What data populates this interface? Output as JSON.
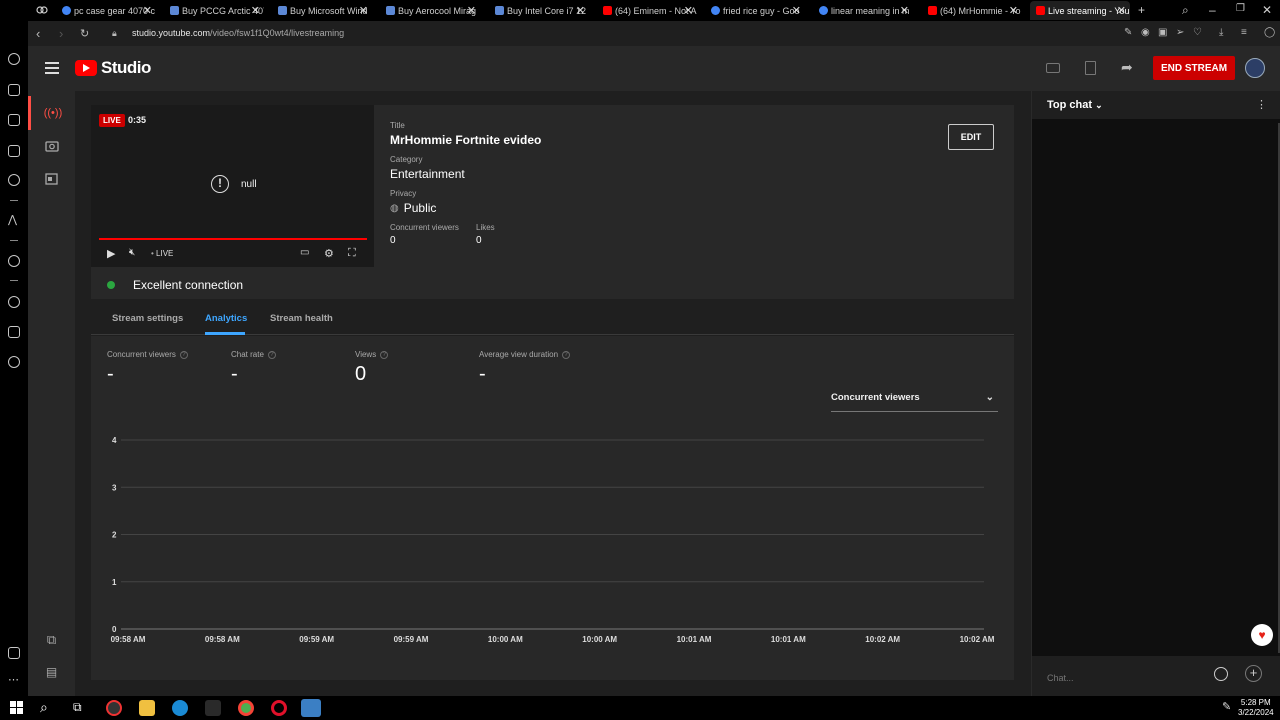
{
  "browser": {
    "tabs": [
      {
        "title": "pc case gear 4070 c",
        "fav": "g"
      },
      {
        "title": "Buy PCCG Arctic 407",
        "fav": "b"
      },
      {
        "title": "Buy Microsoft Wind",
        "fav": "b"
      },
      {
        "title": "Buy Aerocool Mirag",
        "fav": "b"
      },
      {
        "title": "Buy Intel Core i7 12",
        "fav": "b"
      },
      {
        "title": "(64) Eminem - Not A",
        "fav": "y"
      },
      {
        "title": "fried rice guy - Goo",
        "fav": "g"
      },
      {
        "title": "linear meaning in m",
        "fav": "g"
      },
      {
        "title": "(64) MrHommie - Yo",
        "fav": "y"
      },
      {
        "title": "Live streaming - You",
        "fav": "y",
        "active": true
      }
    ],
    "url_host": "studio.youtube.com",
    "url_path": "/video/fsw1f1Q0wt4/livestreaming"
  },
  "header": {
    "app_name": "Studio",
    "end_stream_label": "END STREAM"
  },
  "player": {
    "live_badge": "LIVE",
    "elapsed": "0:35",
    "error_text": "null",
    "live_indicator": "LIVE",
    "progress": 1.0
  },
  "connection": {
    "status": "Excellent connection",
    "color": "#2ba640"
  },
  "stream_info": {
    "title_label": "Title",
    "title": "MrHommie Fortnite evideo",
    "category_label": "Category",
    "category": "Entertainment",
    "privacy_label": "Privacy",
    "privacy": "Public",
    "viewers_label": "Concurrent viewers",
    "viewers": "0",
    "likes_label": "Likes",
    "likes": "0",
    "edit_label": "EDIT"
  },
  "tabs": [
    {
      "label": "Stream settings",
      "active": false
    },
    {
      "label": "Analytics",
      "active": true
    },
    {
      "label": "Stream health",
      "active": false
    }
  ],
  "analytics": {
    "metrics": [
      {
        "label": "Concurrent viewers",
        "value": "-"
      },
      {
        "label": "Chat rate",
        "value": "-"
      },
      {
        "label": "Views",
        "value": "0"
      },
      {
        "label": "Average view duration",
        "value": "-"
      }
    ],
    "dropdown_selected": "Concurrent viewers"
  },
  "chart_data": {
    "type": "line",
    "title": "",
    "xlabel": "",
    "ylabel": "",
    "y_ticks": [
      0,
      1,
      2,
      3,
      4
    ],
    "ylim": [
      0,
      4
    ],
    "x": [
      "09:58 AM",
      "09:58 AM",
      "09:59 AM",
      "09:59 AM",
      "10:00 AM",
      "10:00 AM",
      "10:01 AM",
      "10:01 AM",
      "10:02 AM",
      "10:02 AM"
    ],
    "series": [],
    "grid": true
  },
  "chat": {
    "mode_label": "Top chat",
    "input_placeholder": "Chat..."
  },
  "taskbar": {
    "time": "5:28 PM",
    "date": "3/22/2024"
  },
  "colors": {
    "accent": "#3ea6ff",
    "end_stream": "#cc0000",
    "live": "#cc0000"
  }
}
